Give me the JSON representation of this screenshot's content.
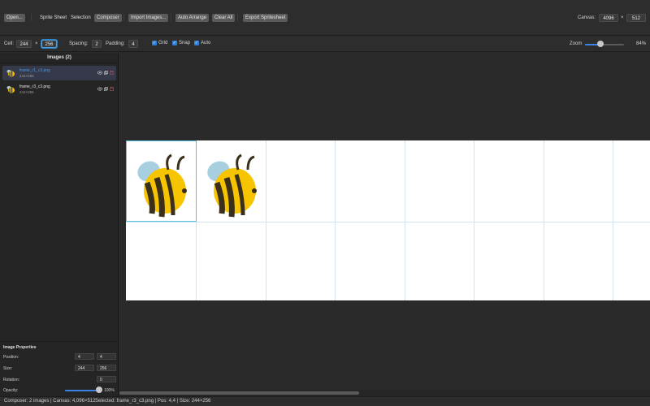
{
  "toolbar": {
    "open_label": "Open...",
    "modes": [
      "Sprite Sheet",
      "Selection",
      "Composer"
    ],
    "active_mode": "Composer",
    "import_label": "Import Images...",
    "auto_arrange_label": "Auto Arrange",
    "clear_all_label": "Clear All",
    "export_label": "Export Spritesheet",
    "canvas_label": "Canvas:",
    "canvas_width": "4096",
    "canvas_times": "×",
    "canvas_height": "512"
  },
  "options": {
    "cell_label": "Cell:",
    "cell_width": "244",
    "cell_times": "×",
    "cell_height": "256",
    "spacing_label": "Spacing:",
    "spacing_value": "2",
    "padding_label": "Padding:",
    "padding_value": "4",
    "grid_label": "Grid",
    "snap_label": "Snap",
    "auto_label": "Auto",
    "grid_checked": true,
    "snap_checked": true,
    "auto_checked": true,
    "zoom_label": "Zoom",
    "zoom_value": "84%",
    "zoom_fraction": 0.4
  },
  "sidebar": {
    "title": "Images (2)",
    "images": [
      {
        "name": "frame_r1_c3.png",
        "size": "244×256",
        "selected": true
      },
      {
        "name": "frame_r3_c3.png",
        "size": "244×256",
        "selected": false
      }
    ],
    "icons": {
      "visibility": "eye-icon",
      "duplicate": "copy-icon",
      "delete": "trash-icon"
    }
  },
  "properties": {
    "title": "Image Properties",
    "position_label": "Position:",
    "position_x": "4",
    "position_y": "4",
    "size_label": "Size:",
    "size_w": "244",
    "size_h": "256",
    "rotation_label": "Rotation:",
    "rotation_value": "0",
    "opacity_label": "Opacity:",
    "opacity_value": "100%",
    "opacity_fraction": 1.0
  },
  "canvas": {
    "columns": 8,
    "rows": 2,
    "sprites": [
      {
        "cell": 0,
        "icon": "bee-sprite",
        "selected": true
      },
      {
        "cell": 1,
        "icon": "bee-sprite",
        "selected": false
      }
    ]
  },
  "status": {
    "left": "Composer: 2 images | Canvas: 4,096×512",
    "right": "Selected: frame_r3_c3.png | Pos: 4,4 | Size: 244×256"
  },
  "colors": {
    "accent": "#3b82e6",
    "selection": "#56c2de",
    "grid": "#cfe4f4",
    "bee_body": "#f6c500",
    "bee_stripes": "#3a2f1a",
    "bee_wings": "#a8cfe0"
  }
}
